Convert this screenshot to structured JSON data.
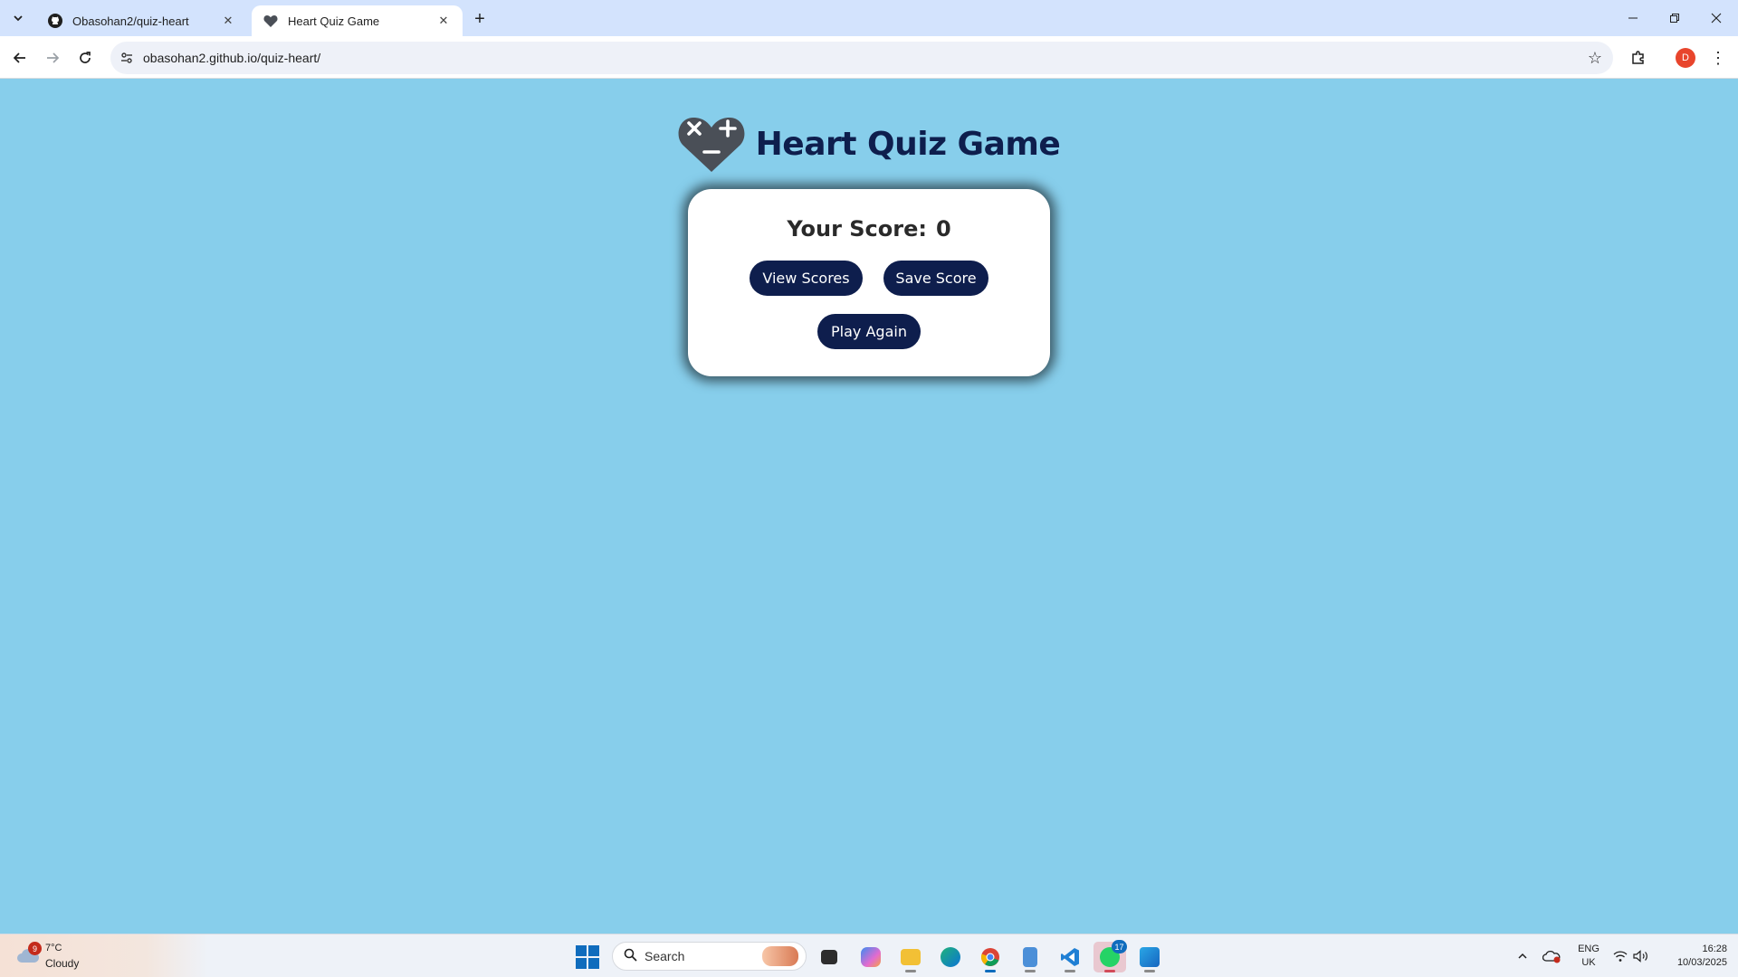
{
  "browser": {
    "tabs": [
      {
        "title": "Obasohan2/quiz-heart",
        "icon": "github-icon",
        "active": false
      },
      {
        "title": "Heart Quiz Game",
        "icon": "heart-icon",
        "active": true
      }
    ],
    "url": "obasohan2.github.io/quiz-heart/",
    "profile_initial": "D"
  },
  "page": {
    "heading": "Heart Quiz Game",
    "score_label": "Your Score:",
    "score_value": "0",
    "buttons": {
      "view_scores": "View Scores",
      "save_score": "Save Score",
      "play_again": "Play Again"
    }
  },
  "taskbar": {
    "weather": {
      "badge": "9",
      "temp": "7°C",
      "desc": "Cloudy"
    },
    "search_placeholder": "Search",
    "whatsapp_badge": "17",
    "lang": {
      "top": "ENG",
      "bottom": "UK"
    },
    "clock": {
      "time": "16:28",
      "date": "10/03/2025"
    }
  },
  "colors": {
    "page_background": "#87ceeb",
    "brand_navy": "#0e1e4d",
    "card_background": "#ffffff"
  }
}
